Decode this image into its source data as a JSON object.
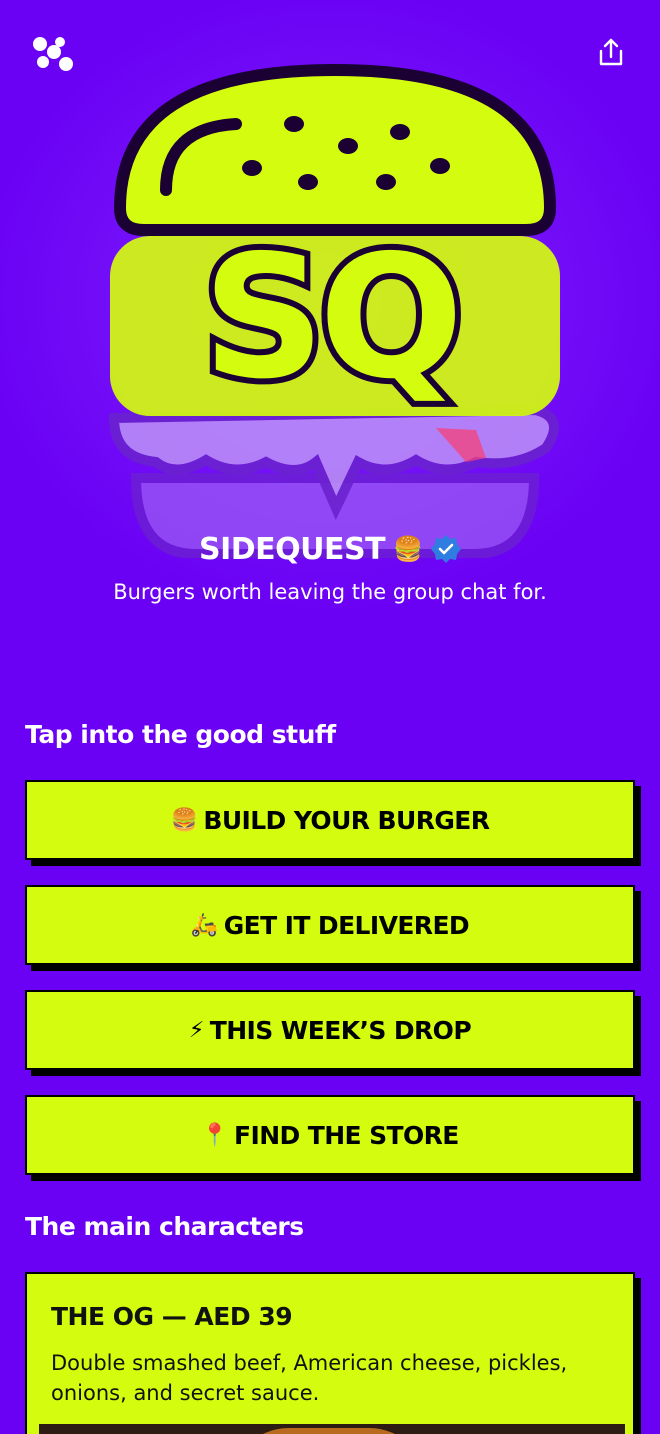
{
  "profile": {
    "name": "SIDEQUEST",
    "name_emoji": "🍔",
    "tagline": "Burgers worth leaving the group chat for.",
    "logo_text": "SQ"
  },
  "sections": {
    "links_title": "Tap into the good stuff",
    "characters_title": "The main characters"
  },
  "links": [
    {
      "emoji": "🍔",
      "label": "BUILD YOUR BURGER"
    },
    {
      "emoji": "🛵",
      "label": "GET IT DELIVERED"
    },
    {
      "emoji": "⚡",
      "label": "THIS WEEK’S DROP"
    },
    {
      "emoji": "📍",
      "label": "FIND THE STORE"
    }
  ],
  "cards": [
    {
      "title": "THE OG — AED 39",
      "description": "Double smashed beef, American cheese, pickles, onions, and secret sauce."
    }
  ],
  "icons": {
    "top_left": "linktree-logo-icon",
    "top_right": "share-icon",
    "verified": "verified-badge-icon"
  },
  "colors": {
    "background": "#6a00f4",
    "accent": "#d4fc0e",
    "text_dark": "#000000",
    "text_light": "#ffffff",
    "verified": "#2f7de1"
  }
}
